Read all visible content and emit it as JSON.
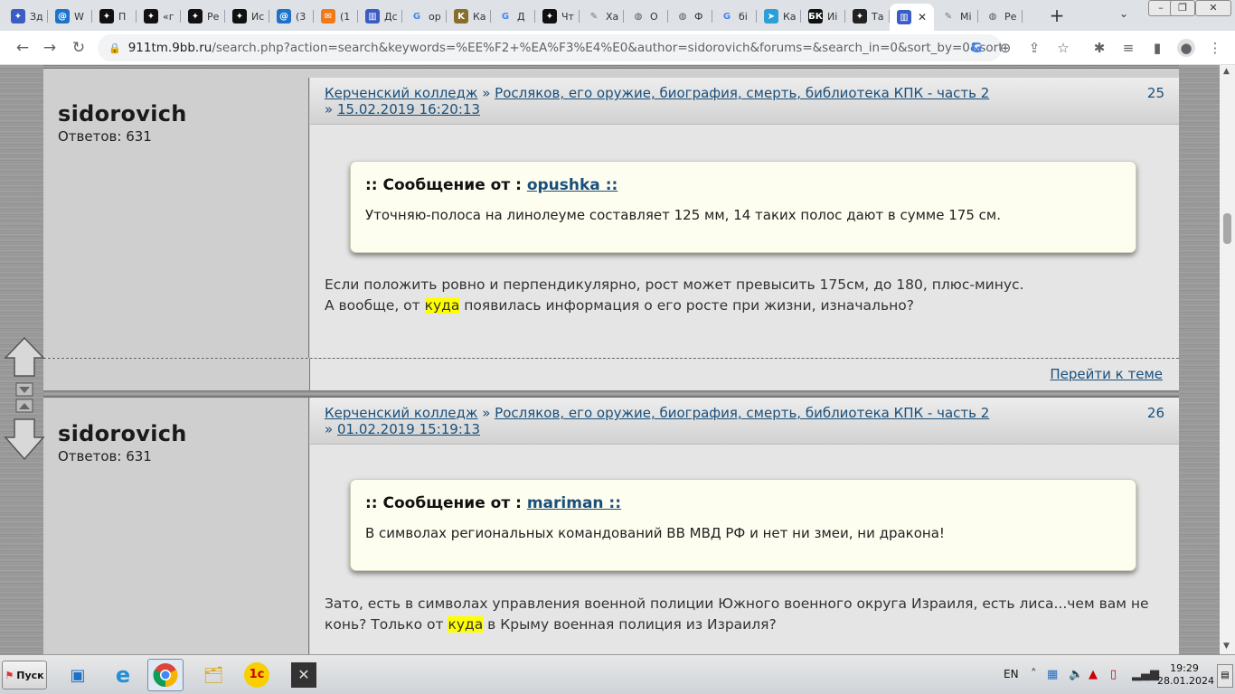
{
  "browser": {
    "tabs": [
      {
        "label": "Зд",
        "icon": "site-icon",
        "color": "#3b5cc4"
      },
      {
        "label": "W",
        "icon": "mail-icon",
        "color": "#1e73c8"
      },
      {
        "label": "П",
        "icon": "site-icon",
        "color": "#111111"
      },
      {
        "label": "«г",
        "icon": "site-icon",
        "color": "#111111"
      },
      {
        "label": "Ре",
        "icon": "site-icon",
        "color": "#111111"
      },
      {
        "label": "Ис",
        "icon": "site-icon",
        "color": "#111111"
      },
      {
        "label": "(3",
        "icon": "mail-icon",
        "color": "#1e73c8"
      },
      {
        "label": "(1",
        "icon": "chat-icon",
        "color": "#f07a1a"
      },
      {
        "label": "Дс",
        "icon": "building-icon",
        "color": "#3b5cc4"
      },
      {
        "label": "ор",
        "icon": "google-icon",
        "color": "#4285f4"
      },
      {
        "label": "Ка",
        "icon": "k-icon",
        "color": "#8a6d2d"
      },
      {
        "label": "Д",
        "icon": "google-icon",
        "color": "#4285f4"
      },
      {
        "label": "Чт",
        "icon": "site-icon",
        "color": "#111111"
      },
      {
        "label": "Ха",
        "icon": "book-icon",
        "color": "#777777"
      },
      {
        "label": "О",
        "icon": "globe-icon",
        "color": "#555555"
      },
      {
        "label": "Ф",
        "icon": "globe-icon",
        "color": "#555555"
      },
      {
        "label": "бі",
        "icon": "google-icon",
        "color": "#4285f4"
      },
      {
        "label": "Ка",
        "icon": "telegram-icon",
        "color": "#2a9fd8"
      },
      {
        "label": "Иі",
        "icon": "bk-icon",
        "color": "#111111"
      },
      {
        "label": "Та",
        "icon": "site-icon",
        "color": "#222222"
      },
      {
        "label": "",
        "icon": "building-icon",
        "color": "#3b5cc4"
      },
      {
        "label": "Мі",
        "icon": "book-icon",
        "color": "#777777"
      },
      {
        "label": "Ре",
        "icon": "globe-icon",
        "color": "#555555"
      }
    ],
    "address": {
      "host": "911tm.9bb.ru",
      "path": "/search.php?action=search&keywords=%EE%F2+%EA%F3%E4%E0&author=sidorovich&forums=&search_in=0&sort_by=0&sort_d..."
    }
  },
  "posts": [
    {
      "author": "sidorovich",
      "replies": "Ответов: 631",
      "forum": "Керченский колледж",
      "sep": "»",
      "topic": "Росляков, его оружие, биография, смерть, библиотека КПК - часть 2",
      "date": "15.02.2019 16:20:13",
      "number": "25",
      "quote_prefix": ":: Сообщение от :",
      "quote_author": "opushka ::",
      "quote_text": "Уточняю-полоса на линолеуме составляет 125 мм, 14 таких полос дают в сумме 175 см.",
      "line1": "Если положить ровно и перпендикулярно, рост может превысить 175см, до 180, плюс-минус.",
      "line2_before": "А вообще, от ",
      "line2_highlight": "куда",
      "line2_after": " появилась информация о его росте при жизни, изначально?",
      "goto": "Перейти к теме"
    },
    {
      "author": "sidorovich",
      "replies": "Ответов: 631",
      "forum": "Керченский колледж",
      "sep": "»",
      "topic": "Росляков, его оружие, биография, смерть, библиотека КПК - часть 2",
      "date": "01.02.2019 15:19:13",
      "number": "26",
      "quote_prefix": ":: Сообщение от :",
      "quote_author": "mariman ::",
      "quote_text": "В символах региональных командований ВВ МВД РФ и нет ни змеи, ни дракона!",
      "line1": "Зато, есть в символах управления военной полиции Южного военного округа Израиля, есть лиса...чем вам не",
      "line2_before": "конь? Только от ",
      "line2_highlight": "куда",
      "line2_after": " в Крыму военная полиция из Израиля?"
    }
  ],
  "taskbar": {
    "start": "Пуск",
    "lang": "EN",
    "time": "19:29",
    "date": "28.01.2024"
  }
}
